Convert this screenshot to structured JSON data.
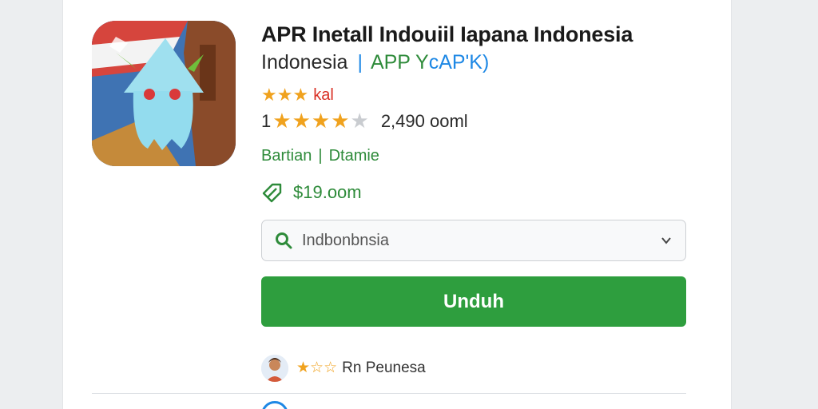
{
  "app": {
    "title": "APR Inetall Indouiil Iapana Indonesia",
    "subtitle_country": "Indonesia",
    "subtitle_sep": "|",
    "subtitle_tag_a": "APP Y",
    "subtitle_tag_b": "cAP'K)",
    "rating_small_label": "kal",
    "rating_small_stars": 3,
    "rating_prefix": "1",
    "rating_stars": 4,
    "rating_max": 5,
    "downloads": "2,490 ooml",
    "developer": "Bartian",
    "developer_sep": "|",
    "category": "Dtamie",
    "price": "$19.oom"
  },
  "region_select": {
    "value": "Indbonbnsia"
  },
  "download_button": {
    "label": "Unduh"
  },
  "review": {
    "stars": 1,
    "stars_max": 3,
    "name": "Rn Peunesa"
  },
  "icons": [
    "app-icon",
    "star-icon",
    "price-tag-icon",
    "search-icon",
    "chevron-down-icon",
    "avatar"
  ],
  "colors": {
    "accent_green": "#2e9e3e",
    "link_blue": "#1e88e5",
    "star_gold": "#f0a21e",
    "red": "#d93025"
  }
}
